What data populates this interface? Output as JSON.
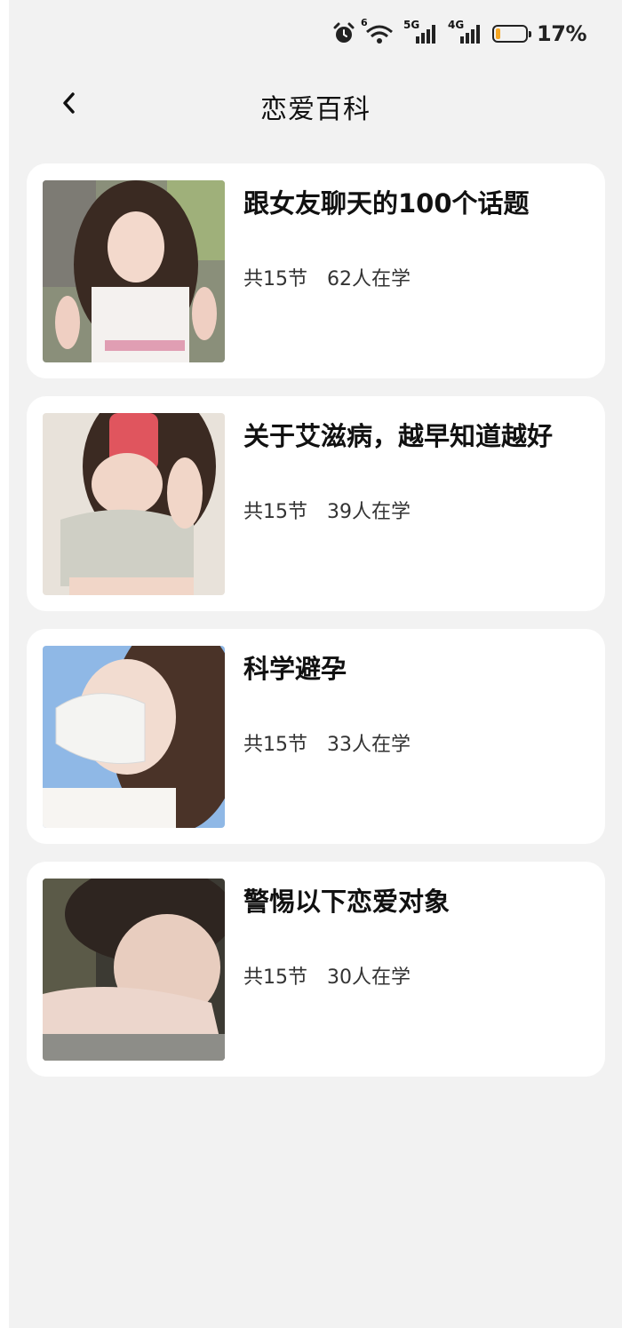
{
  "status_bar": {
    "icons": [
      "alarm-icon",
      "wifi-icon",
      "signal-5g-icon",
      "signal-4g-icon",
      "battery-icon"
    ],
    "wifi_badge": "6",
    "net_5g": "5G",
    "net_4g": "4G",
    "battery_percent": "17%",
    "battery_level": 0.17,
    "battery_color": "#f5a623"
  },
  "header": {
    "title": "恋爱百科",
    "back_icon": "chevron-left-icon"
  },
  "courses": [
    {
      "title": "跟女友聊天的100个话题",
      "lessons": "共15节",
      "learners": "62人在学"
    },
    {
      "title": "关于艾滋病，越早知道越好",
      "lessons": "共15节",
      "learners": "39人在学"
    },
    {
      "title": "科学避孕",
      "lessons": "共15节",
      "learners": "33人在学"
    },
    {
      "title": "警惕以下恋爱对象",
      "lessons": "共15节",
      "learners": "30人在学"
    }
  ],
  "colors": {
    "background": "#f2f2f2",
    "card": "#ffffff",
    "text": "#111111"
  }
}
